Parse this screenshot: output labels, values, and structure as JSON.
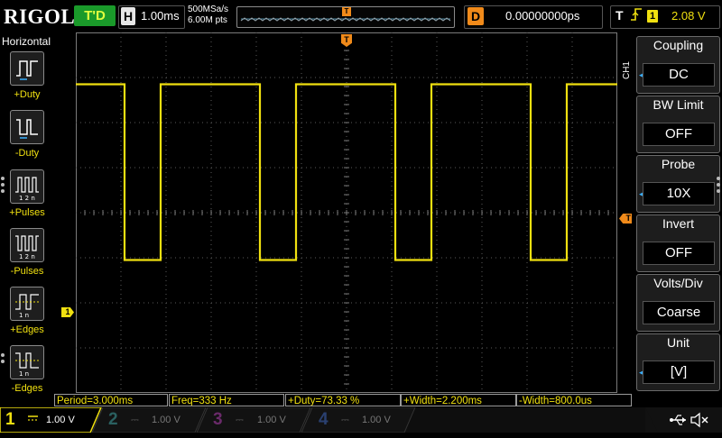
{
  "brand": "RIGOL",
  "run_state": "T'D",
  "horizontal": {
    "tag": "H",
    "timebase": "1.00ms",
    "sample_rate": "500MSa/s",
    "memory_depth": "6.00M pts"
  },
  "trigger_position_marker": "T",
  "delay": {
    "tag": "D",
    "value": "0.00000000ps"
  },
  "trigger": {
    "tag": "T",
    "edge_icon": "rising-edge-icon",
    "source": "1",
    "level": "2.08 V"
  },
  "left_menu": {
    "title": "Horizontal",
    "items": [
      {
        "label": "+Duty",
        "icon": "positive-duty-icon"
      },
      {
        "label": "-Duty",
        "icon": "negative-duty-icon"
      },
      {
        "label": "+Pulses",
        "icon": "positive-pulses-icon"
      },
      {
        "label": "-Pulses",
        "icon": "negative-pulses-icon"
      },
      {
        "label": "+Edges",
        "icon": "positive-edges-icon"
      },
      {
        "label": "-Edges",
        "icon": "negative-edges-icon"
      }
    ]
  },
  "channel_ground_marker": "1",
  "trigger_level_marker": "T",
  "measurements": [
    "Period=3.000ms",
    "Freq=333 Hz",
    "+Duty=73.33 %",
    "+Width=2.200ms",
    "-Width=800.0us"
  ],
  "right_menu": {
    "channel": "CH1",
    "items": [
      {
        "title": "Coupling",
        "value": "DC"
      },
      {
        "title": "BW Limit",
        "value": "OFF"
      },
      {
        "title": "Probe",
        "value": "10X"
      },
      {
        "title": "Invert",
        "value": "OFF"
      },
      {
        "title": "Volts/Div",
        "value": "Coarse"
      },
      {
        "title": "Unit",
        "value": "[V]"
      }
    ]
  },
  "channels": [
    {
      "number": "1",
      "scale": "1.00 V",
      "color": "#f0e010",
      "active": true
    },
    {
      "number": "2",
      "scale": "1.00 V",
      "color": "#2aa7a0",
      "active": false
    },
    {
      "number": "3",
      "scale": "1.00 V",
      "color": "#c03ac0",
      "active": false
    },
    {
      "number": "4",
      "scale": "1.00 V",
      "color": "#2a5ab0",
      "active": false
    }
  ],
  "status_icons": [
    "usb-icon",
    "mute-speaker-icon"
  ],
  "colors": {
    "ch1": "#f0e010",
    "trigger": "#f08a1a",
    "grid": "#5a5a5a",
    "menu_accent": "#3ab0ff"
  },
  "waveform": {
    "timebase_ms_per_div": 1.0,
    "volts_per_div": 1.0,
    "period_ms": 3.0,
    "high_width_ms": 2.2,
    "low_width_ms": 0.8,
    "first_falling_edge_div": 1.08,
    "high_level_div_above_center": 2.85,
    "low_level_div_below_center": 1.05
  }
}
